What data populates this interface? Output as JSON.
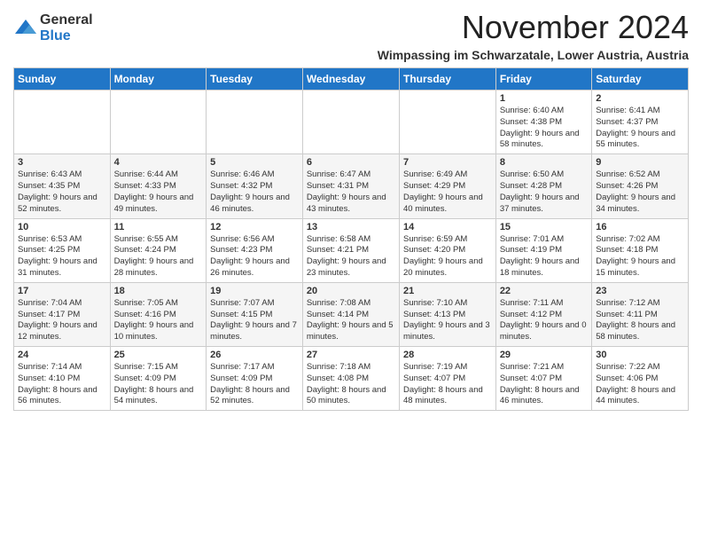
{
  "logo": {
    "general": "General",
    "blue": "Blue"
  },
  "title": "November 2024",
  "subtitle": "Wimpassing im Schwarzatale, Lower Austria, Austria",
  "days_of_week": [
    "Sunday",
    "Monday",
    "Tuesday",
    "Wednesday",
    "Thursday",
    "Friday",
    "Saturday"
  ],
  "weeks": [
    [
      {
        "day": "",
        "info": ""
      },
      {
        "day": "",
        "info": ""
      },
      {
        "day": "",
        "info": ""
      },
      {
        "day": "",
        "info": ""
      },
      {
        "day": "",
        "info": ""
      },
      {
        "day": "1",
        "info": "Sunrise: 6:40 AM\nSunset: 4:38 PM\nDaylight: 9 hours and 58 minutes."
      },
      {
        "day": "2",
        "info": "Sunrise: 6:41 AM\nSunset: 4:37 PM\nDaylight: 9 hours and 55 minutes."
      }
    ],
    [
      {
        "day": "3",
        "info": "Sunrise: 6:43 AM\nSunset: 4:35 PM\nDaylight: 9 hours and 52 minutes."
      },
      {
        "day": "4",
        "info": "Sunrise: 6:44 AM\nSunset: 4:33 PM\nDaylight: 9 hours and 49 minutes."
      },
      {
        "day": "5",
        "info": "Sunrise: 6:46 AM\nSunset: 4:32 PM\nDaylight: 9 hours and 46 minutes."
      },
      {
        "day": "6",
        "info": "Sunrise: 6:47 AM\nSunset: 4:31 PM\nDaylight: 9 hours and 43 minutes."
      },
      {
        "day": "7",
        "info": "Sunrise: 6:49 AM\nSunset: 4:29 PM\nDaylight: 9 hours and 40 minutes."
      },
      {
        "day": "8",
        "info": "Sunrise: 6:50 AM\nSunset: 4:28 PM\nDaylight: 9 hours and 37 minutes."
      },
      {
        "day": "9",
        "info": "Sunrise: 6:52 AM\nSunset: 4:26 PM\nDaylight: 9 hours and 34 minutes."
      }
    ],
    [
      {
        "day": "10",
        "info": "Sunrise: 6:53 AM\nSunset: 4:25 PM\nDaylight: 9 hours and 31 minutes."
      },
      {
        "day": "11",
        "info": "Sunrise: 6:55 AM\nSunset: 4:24 PM\nDaylight: 9 hours and 28 minutes."
      },
      {
        "day": "12",
        "info": "Sunrise: 6:56 AM\nSunset: 4:23 PM\nDaylight: 9 hours and 26 minutes."
      },
      {
        "day": "13",
        "info": "Sunrise: 6:58 AM\nSunset: 4:21 PM\nDaylight: 9 hours and 23 minutes."
      },
      {
        "day": "14",
        "info": "Sunrise: 6:59 AM\nSunset: 4:20 PM\nDaylight: 9 hours and 20 minutes."
      },
      {
        "day": "15",
        "info": "Sunrise: 7:01 AM\nSunset: 4:19 PM\nDaylight: 9 hours and 18 minutes."
      },
      {
        "day": "16",
        "info": "Sunrise: 7:02 AM\nSunset: 4:18 PM\nDaylight: 9 hours and 15 minutes."
      }
    ],
    [
      {
        "day": "17",
        "info": "Sunrise: 7:04 AM\nSunset: 4:17 PM\nDaylight: 9 hours and 12 minutes."
      },
      {
        "day": "18",
        "info": "Sunrise: 7:05 AM\nSunset: 4:16 PM\nDaylight: 9 hours and 10 minutes."
      },
      {
        "day": "19",
        "info": "Sunrise: 7:07 AM\nSunset: 4:15 PM\nDaylight: 9 hours and 7 minutes."
      },
      {
        "day": "20",
        "info": "Sunrise: 7:08 AM\nSunset: 4:14 PM\nDaylight: 9 hours and 5 minutes."
      },
      {
        "day": "21",
        "info": "Sunrise: 7:10 AM\nSunset: 4:13 PM\nDaylight: 9 hours and 3 minutes."
      },
      {
        "day": "22",
        "info": "Sunrise: 7:11 AM\nSunset: 4:12 PM\nDaylight: 9 hours and 0 minutes."
      },
      {
        "day": "23",
        "info": "Sunrise: 7:12 AM\nSunset: 4:11 PM\nDaylight: 8 hours and 58 minutes."
      }
    ],
    [
      {
        "day": "24",
        "info": "Sunrise: 7:14 AM\nSunset: 4:10 PM\nDaylight: 8 hours and 56 minutes."
      },
      {
        "day": "25",
        "info": "Sunrise: 7:15 AM\nSunset: 4:09 PM\nDaylight: 8 hours and 54 minutes."
      },
      {
        "day": "26",
        "info": "Sunrise: 7:17 AM\nSunset: 4:09 PM\nDaylight: 8 hours and 52 minutes."
      },
      {
        "day": "27",
        "info": "Sunrise: 7:18 AM\nSunset: 4:08 PM\nDaylight: 8 hours and 50 minutes."
      },
      {
        "day": "28",
        "info": "Sunrise: 7:19 AM\nSunset: 4:07 PM\nDaylight: 8 hours and 48 minutes."
      },
      {
        "day": "29",
        "info": "Sunrise: 7:21 AM\nSunset: 4:07 PM\nDaylight: 8 hours and 46 minutes."
      },
      {
        "day": "30",
        "info": "Sunrise: 7:22 AM\nSunset: 4:06 PM\nDaylight: 8 hours and 44 minutes."
      }
    ]
  ]
}
